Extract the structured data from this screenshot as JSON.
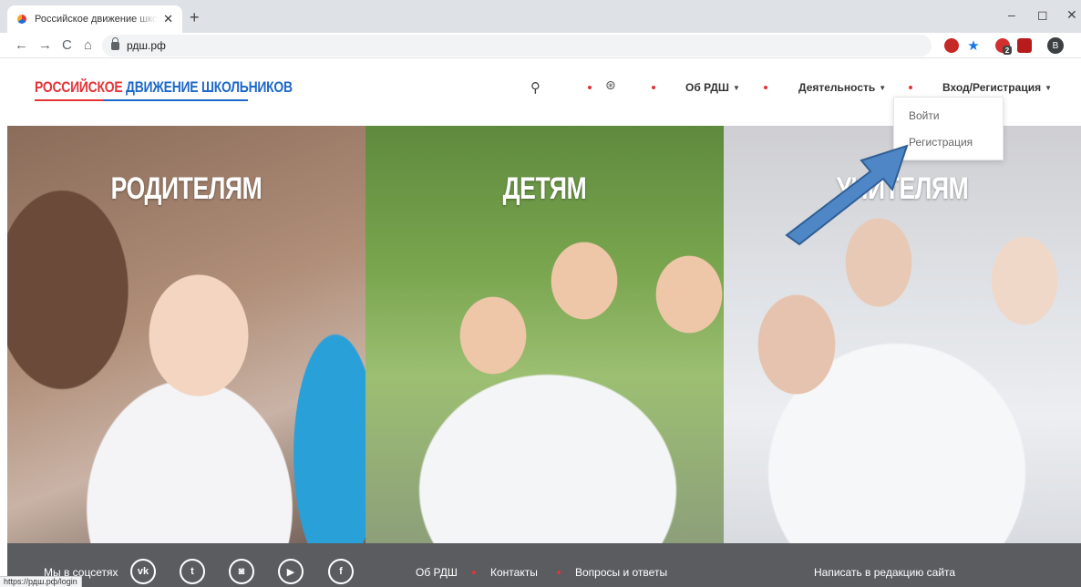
{
  "browser": {
    "tab_title": "Российское движение школьн",
    "tab_close": "✕",
    "new_tab": "+",
    "url": "рдш.рф",
    "nav": {
      "back": "←",
      "forward": "→",
      "reload": "C",
      "home": "⌂"
    },
    "window": {
      "minimize": "–",
      "maximize": "◻",
      "close": "✕"
    },
    "extensions": [
      {
        "name": "ext-red-icon",
        "color": "#c62828"
      },
      {
        "name": "star-icon",
        "color": "#1a73e8"
      },
      {
        "name": "ext-opera-icon",
        "color": "#d32f2f",
        "badge": "2"
      },
      {
        "name": "pdf-icon",
        "color": "#b71c1c"
      }
    ],
    "profile_initial": "В",
    "status_url": "https://рдш.рф/login"
  },
  "site": {
    "logo": {
      "part1": "РОССИЙСКОЕ",
      "part2": "ДВИЖЕНИЕ ШКОЛЬНИКОВ"
    },
    "nav": {
      "about": "Об РДШ",
      "activity": "Деятельность",
      "login_register": "Вход/Регистрация",
      "caret": "▼"
    },
    "dropdown": {
      "login": "Войти",
      "register": "Регистрация"
    },
    "panels": {
      "parents": "РОДИТЕЛЯМ",
      "kids": "ДЕТЯМ",
      "teachers": "УЧИТЕЛЯМ"
    },
    "footer": {
      "social_label": "Мы в соцсетях",
      "social": {
        "vk": "vk",
        "twitter": "t",
        "instagram": "◙",
        "youtube": "▶",
        "facebook": "f"
      },
      "links": {
        "about": "Об РДШ",
        "contacts": "Контакты",
        "faq": "Вопросы и ответы"
      },
      "write": "Написать в редакцию сайта"
    }
  },
  "colors": {
    "accent_red": "#e53338",
    "accent_blue": "#1d68c8",
    "footer_bg": "#5b5c60",
    "arrow": "#4f86c6"
  }
}
